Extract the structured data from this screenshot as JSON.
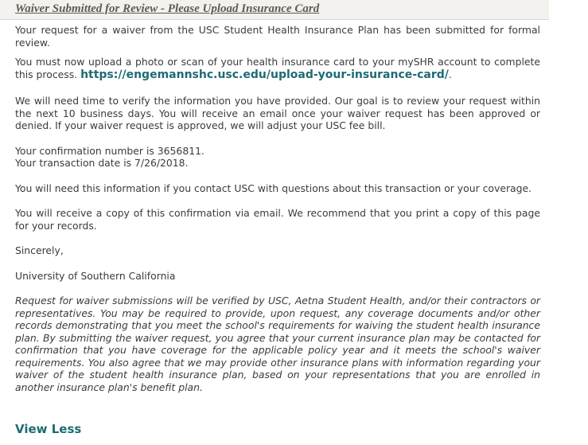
{
  "header": {
    "title": "Waiver Submitted for Review - Please Upload Insurance Card"
  },
  "body": {
    "p1": "Your request for a waiver from the USC Student Health Insurance Plan has been submitted for formal review.",
    "p2_text": "You must now upload a photo or scan of your health insurance card to your mySHR account to complete this process.",
    "p2_link": "https://engemannshc.usc.edu/upload-your-insurance-card/",
    "p2_end": ".",
    "p3": "We will need time to verify the information you have provided. Our goal is to review your request within the next 10 business days.  You will receive an email once your waiver request has been approved or denied. If your waiver request is approved, we will adjust your USC fee bill.",
    "confirmation_line": "Your confirmation number is 3656811.",
    "transaction_line": "Your transaction date is 7/26/2018.",
    "p5": "You will need this information if you contact USC with questions about this transaction or your coverage.",
    "p6": "You will receive a copy of this confirmation via email. We recommend that you print a copy of this page for your records.",
    "closing": "Sincerely,",
    "signature": "University of Southern California",
    "disclaimer": "Request for waiver submissions will be verified by USC, Aetna Student Health, and/or their contractors or representatives.  You may be required to provide, upon request, any coverage documents and/or other records demonstrating that you meet the school's requirements for waiving the student health insurance plan.  By submitting the waiver request, you agree that your current insurance plan may be contacted for confirmation that you have coverage for the applicable policy year and it meets the school's waiver requirements.  You also agree that we may provide other insurance plans with information regarding your waiver of the student health insurance plan, based on your representations that you are enrolled in another insurance plan's benefit plan."
  },
  "footer": {
    "view_less_label": "View Less"
  },
  "colors": {
    "link": "#1e6b73",
    "text": "#3b3b3b",
    "header_bg": "#f3f2ee"
  }
}
